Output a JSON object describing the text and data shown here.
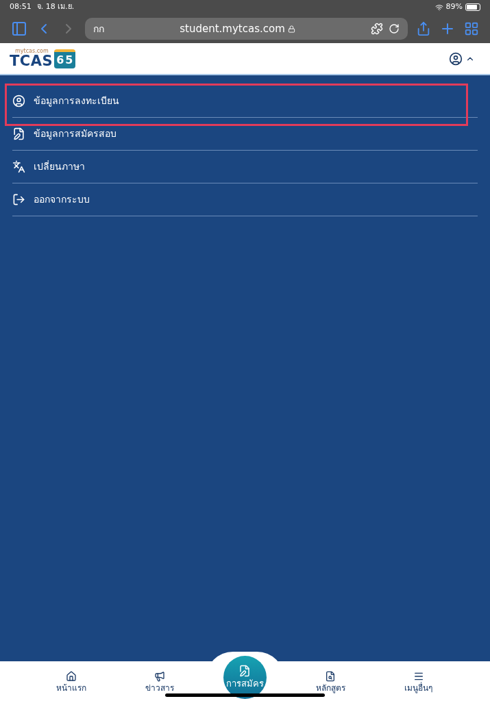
{
  "status_bar": {
    "time": "08:51",
    "date": "จ. 18 เม.ย.",
    "battery": "89%"
  },
  "browser": {
    "text_size": "กก",
    "url": "student.mytcas.com"
  },
  "header": {
    "logo": {
      "site": "mytcas.com",
      "name": "TCAS",
      "digits": [
        "6",
        "5"
      ]
    }
  },
  "menu": [
    {
      "label": "ข้อมูลการลงทะเบียน",
      "kind": "profile",
      "highlighted": true
    },
    {
      "label": "ข้อมูลการสมัครสอบ",
      "kind": "form",
      "highlighted": false
    },
    {
      "label": "เปลี่ยนภาษา",
      "kind": "language",
      "highlighted": false
    },
    {
      "label": "ออกจากระบบ",
      "kind": "logout",
      "highlighted": false
    }
  ],
  "bottom_nav": [
    {
      "label": "หน้าแรก",
      "kind": "home"
    },
    {
      "label": "ข่าวสาร",
      "kind": "news"
    },
    {
      "label": "การสมัคร",
      "kind": "apply"
    },
    {
      "label": "หลักสูตร",
      "kind": "courses"
    },
    {
      "label": "เมนูอื่นๆ",
      "kind": "more"
    }
  ]
}
